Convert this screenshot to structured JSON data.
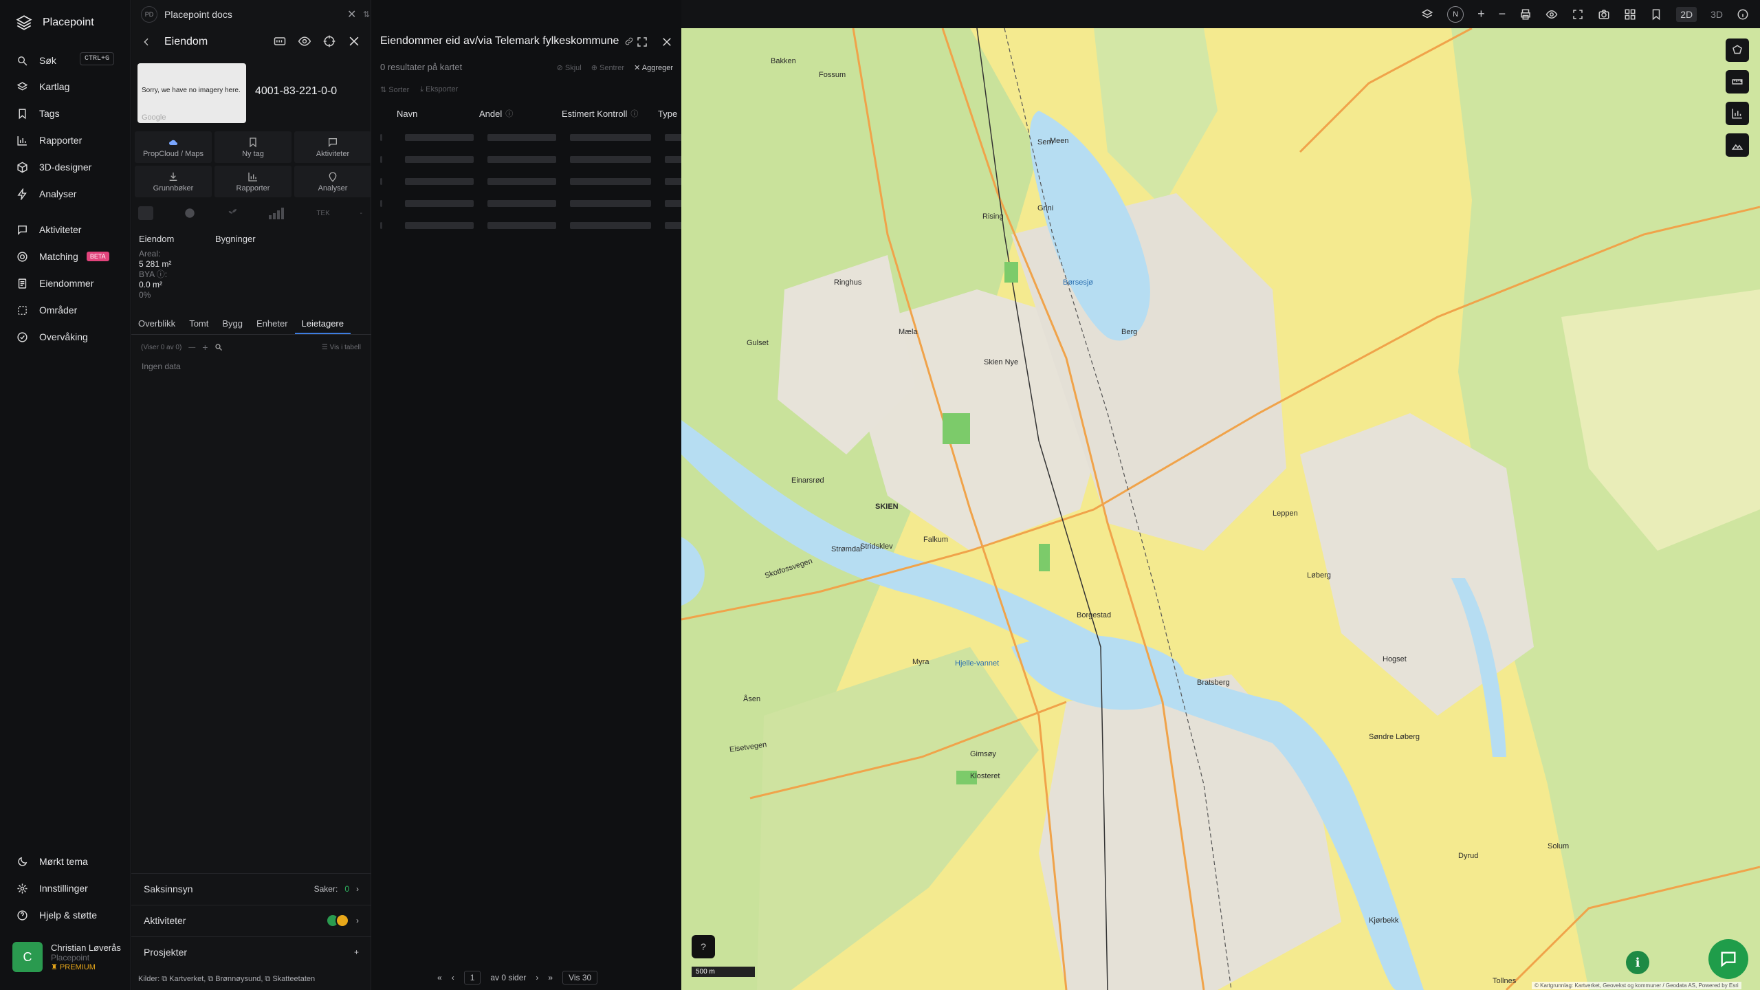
{
  "brand": {
    "name": "Placepoint"
  },
  "nav": {
    "search": {
      "label": "Søk",
      "shortcut": "CTRL+G"
    },
    "items": [
      {
        "label": "Kartlag"
      },
      {
        "label": "Tags"
      },
      {
        "label": "Rapporter"
      },
      {
        "label": "3D-designer"
      },
      {
        "label": "Analyser"
      }
    ],
    "items2": [
      {
        "label": "Aktiviteter"
      },
      {
        "label": "Matching",
        "badge": "BETA"
      },
      {
        "label": "Eiendommer"
      },
      {
        "label": "Områder"
      },
      {
        "label": "Overvåking"
      }
    ],
    "bottom": [
      {
        "label": "Mørkt tema"
      },
      {
        "label": "Innstillinger"
      },
      {
        "label": "Hjelp & støtte"
      }
    ],
    "user": {
      "initial": "C",
      "name": "Christian Løverås",
      "org": "Placepoint",
      "plan": "PREMIUM"
    }
  },
  "docs": {
    "badge": "PD",
    "title": "Placepoint docs"
  },
  "property": {
    "title": "Eiendom",
    "image_text": "Sorry, we have no imagery here.",
    "image_credit": "Google",
    "id": "4001-83-221-0-0",
    "buttons": [
      "PropCloud / Maps",
      "Ny tag",
      "Aktiviteter",
      "Grunnbøker",
      "Rapporter",
      "Analyser"
    ],
    "toolrow": {
      "tek": "TEK",
      "dash": "-"
    },
    "section_a": "Eiendom",
    "section_b": "Bygninger",
    "stats": {
      "areal_label": "Areal:",
      "areal_value": "5 281 m²",
      "bya_label": "BYA ⓘ:",
      "bya_value": "0.0 m²",
      "bya_pct": "0%"
    },
    "tabs": [
      "Overblikk",
      "Tomt",
      "Bygg",
      "Enheter",
      "Leietagere"
    ],
    "active_tab": "Leietagere",
    "showing": "(Viser 0 av 0)",
    "table_view": "Vis i tabell",
    "no_data": "Ingen data",
    "accordions": {
      "saksinnsyn": {
        "label": "Saksinnsyn",
        "count_label": "Saker:",
        "count": "0"
      },
      "aktiviteter": {
        "label": "Aktiviteter"
      },
      "prosjekter": {
        "label": "Prosjekter",
        "action": "+"
      }
    },
    "sources": "Kilder: ⧉ Kartverket, ⧉ Brønnøysund, ⧉ Skatteetaten"
  },
  "owners": {
    "title": "Eiendommer eid av/via Telemark fylkeskommune",
    "subtitle": "0 resultater på kartet",
    "actions": [
      "Skjul",
      "Sentrer",
      "Aggreger"
    ],
    "tools": [
      "Sorter",
      "Eksporter"
    ],
    "columns": [
      "Navn",
      "Andel",
      "Estimert Kontroll",
      "Type"
    ],
    "pager": {
      "page": "1",
      "of": "av 0 sider",
      "per_page": "Vis 30"
    }
  },
  "topbar": {
    "compass": "N",
    "mode_2d": "2D",
    "mode_3d": "3D"
  },
  "map": {
    "labels": [
      "SKIEN",
      "Børsesjø",
      "Hjelle-vannet",
      "Myra",
      "Falkum",
      "Gimsøy",
      "Klosteret",
      "Skien Nye",
      "Fossum",
      "Bakken",
      "Åsen",
      "Gulset",
      "Einarsrød",
      "Stridsklev",
      "Borgestad",
      "Bratsberg",
      "Leppen",
      "Løberg",
      "Hogset",
      "Søndre Løberg",
      "Solum",
      "Meen",
      "Rising",
      "Mæla",
      "Ringhus",
      "Skotfossvegen",
      "Eisetvegen",
      "Tollnes",
      "Strømdal",
      "Kjørbekk",
      "Dyrud",
      "Grini",
      "Sem",
      "Berg"
    ],
    "scale": "500 m",
    "attribution": "© Kartgrunnlag: Kartverket, Geovekst og kommuner / Geodata AS, Powered by Esri"
  },
  "colors": {
    "accent": "#3d7de0",
    "green": "#1f9d4a",
    "beta": "#e2447c",
    "premium": "#e8a81a"
  }
}
